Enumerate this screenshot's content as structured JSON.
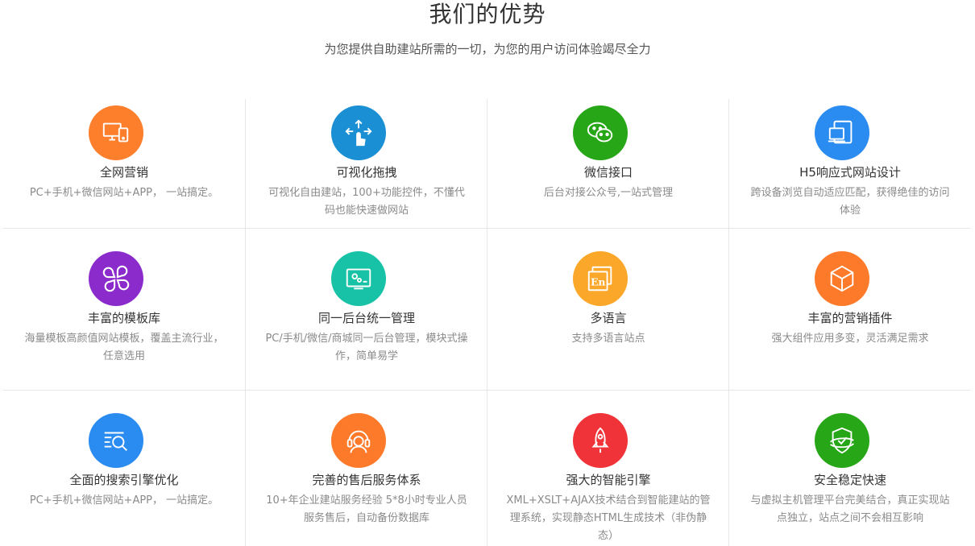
{
  "header": {
    "title": "我们的优势",
    "subtitle": "为您提供自助建站所需的一切，为您的用户访问体验竭尽全力"
  },
  "features": [
    {
      "title": "全网营销",
      "desc": "PC+手机+微信网站+APP， 一站搞定。",
      "icon": "devices-icon",
      "color": "#fd7f2c"
    },
    {
      "title": "可视化拖拽",
      "desc": "可视化自由建站，100+功能控件，不懂代码也能快速做网站",
      "icon": "drag-hand-icon",
      "color": "#1a8fd3"
    },
    {
      "title": "微信接口",
      "desc": "后台对接公众号,一站式管理",
      "icon": "wechat-icon",
      "color": "#27a617"
    },
    {
      "title": "H5响应式网站设计",
      "desc": "跨设备浏览自动适应匹配，获得绝佳的访问体验",
      "icon": "responsive-devices-icon",
      "color": "#2a8cf0"
    },
    {
      "title": "丰富的模板库",
      "desc": "海量模板高颜值网站模板，覆盖主流行业，任意选用",
      "icon": "template-grid-icon",
      "color": "#8c2bcc"
    },
    {
      "title": "同一后台统一管理",
      "desc": "PC/手机/微信/商城同一后台管理，模块式操作，简单易学",
      "icon": "admin-panel-icon",
      "color": "#17c2a6"
    },
    {
      "title": "多语言",
      "desc": "支持多语言站点",
      "icon": "language-icon",
      "color": "#fba72a"
    },
    {
      "title": "丰富的营销插件",
      "desc": "强大组件应用多变，灵活满足需求",
      "icon": "cube-icon",
      "color": "#fd7a2a"
    },
    {
      "title": "全面的搜索引擎优化",
      "desc": "PC+手机+微信网站+APP， 一站搞定。",
      "icon": "seo-search-icon",
      "color": "#2a8cf0"
    },
    {
      "title": "完善的售后服务体系",
      "desc": "10+年企业建站服务经验 5*8小时专业人员服务售后，自动备份数据库",
      "icon": "headset-icon",
      "color": "#fd7a2a"
    },
    {
      "title": "强大的智能引擎",
      "desc": "XML+XSLT+AJAX技术结合到智能建站的管理系统，实现静态HTML生成技术（非伪静态）",
      "icon": "rocket-icon",
      "color": "#ef3338"
    },
    {
      "title": "安全稳定快速",
      "desc": "与虚拟主机管理平台完美结合，真正实现站点独立，站点之间不会相互影响",
      "icon": "shield-icon",
      "color": "#27a617"
    }
  ]
}
